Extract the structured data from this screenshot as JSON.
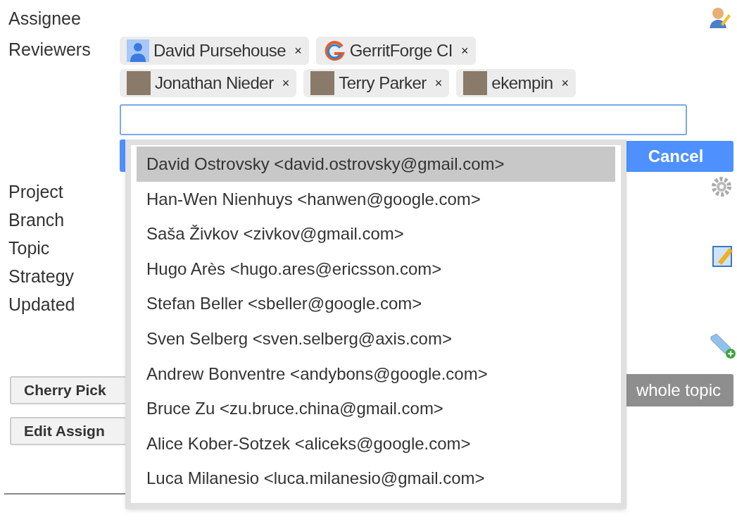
{
  "fields": [
    {
      "label": "Assignee"
    },
    {
      "label": "Reviewers"
    }
  ],
  "reviewer_rows": [
    [
      {
        "name": "David Pursehouse",
        "kind": "silhouette"
      },
      {
        "name": "GerritForge CI",
        "kind": "logo"
      }
    ],
    [
      {
        "name": "Jonathan Nieder",
        "kind": "photo"
      },
      {
        "name": "Terry Parker",
        "kind": "photo"
      },
      {
        "name": "ekempin",
        "kind": "photo"
      }
    ]
  ],
  "remove_mark": "×",
  "cancel_button": "Cancel",
  "info": [
    {
      "label": "Project"
    },
    {
      "label": "Branch"
    },
    {
      "label": "Topic"
    },
    {
      "label": "Strategy"
    },
    {
      "label": "Updated"
    }
  ],
  "buttons": [
    "Cherry Pick",
    "Edit Assign"
  ],
  "topic_button": "whole topic",
  "suggestions": [
    {
      "text": "David Ostrovsky <david.ostrovsky@gmail.com>",
      "selected": true
    },
    {
      "text": "Han-Wen Nienhuys <hanwen@google.com>",
      "selected": false
    },
    {
      "text": "Saša Živkov <zivkov@gmail.com>",
      "selected": false
    },
    {
      "text": "Hugo Arès <hugo.ares@ericsson.com>",
      "selected": false
    },
    {
      "text": "Stefan Beller <sbeller@google.com>",
      "selected": false
    },
    {
      "text": "Sven Selberg <sven.selberg@axis.com>",
      "selected": false
    },
    {
      "text": "Andrew Bonventre <andybons@google.com>",
      "selected": false
    },
    {
      "text": "Bruce Zu <zu.bruce.china@gmail.com>",
      "selected": false
    },
    {
      "text": "Alice Kober-Sotzek <aliceks@google.com>",
      "selected": false
    },
    {
      "text": "Luca Milanesio <luca.milanesio@gmail.com>",
      "selected": false
    }
  ]
}
